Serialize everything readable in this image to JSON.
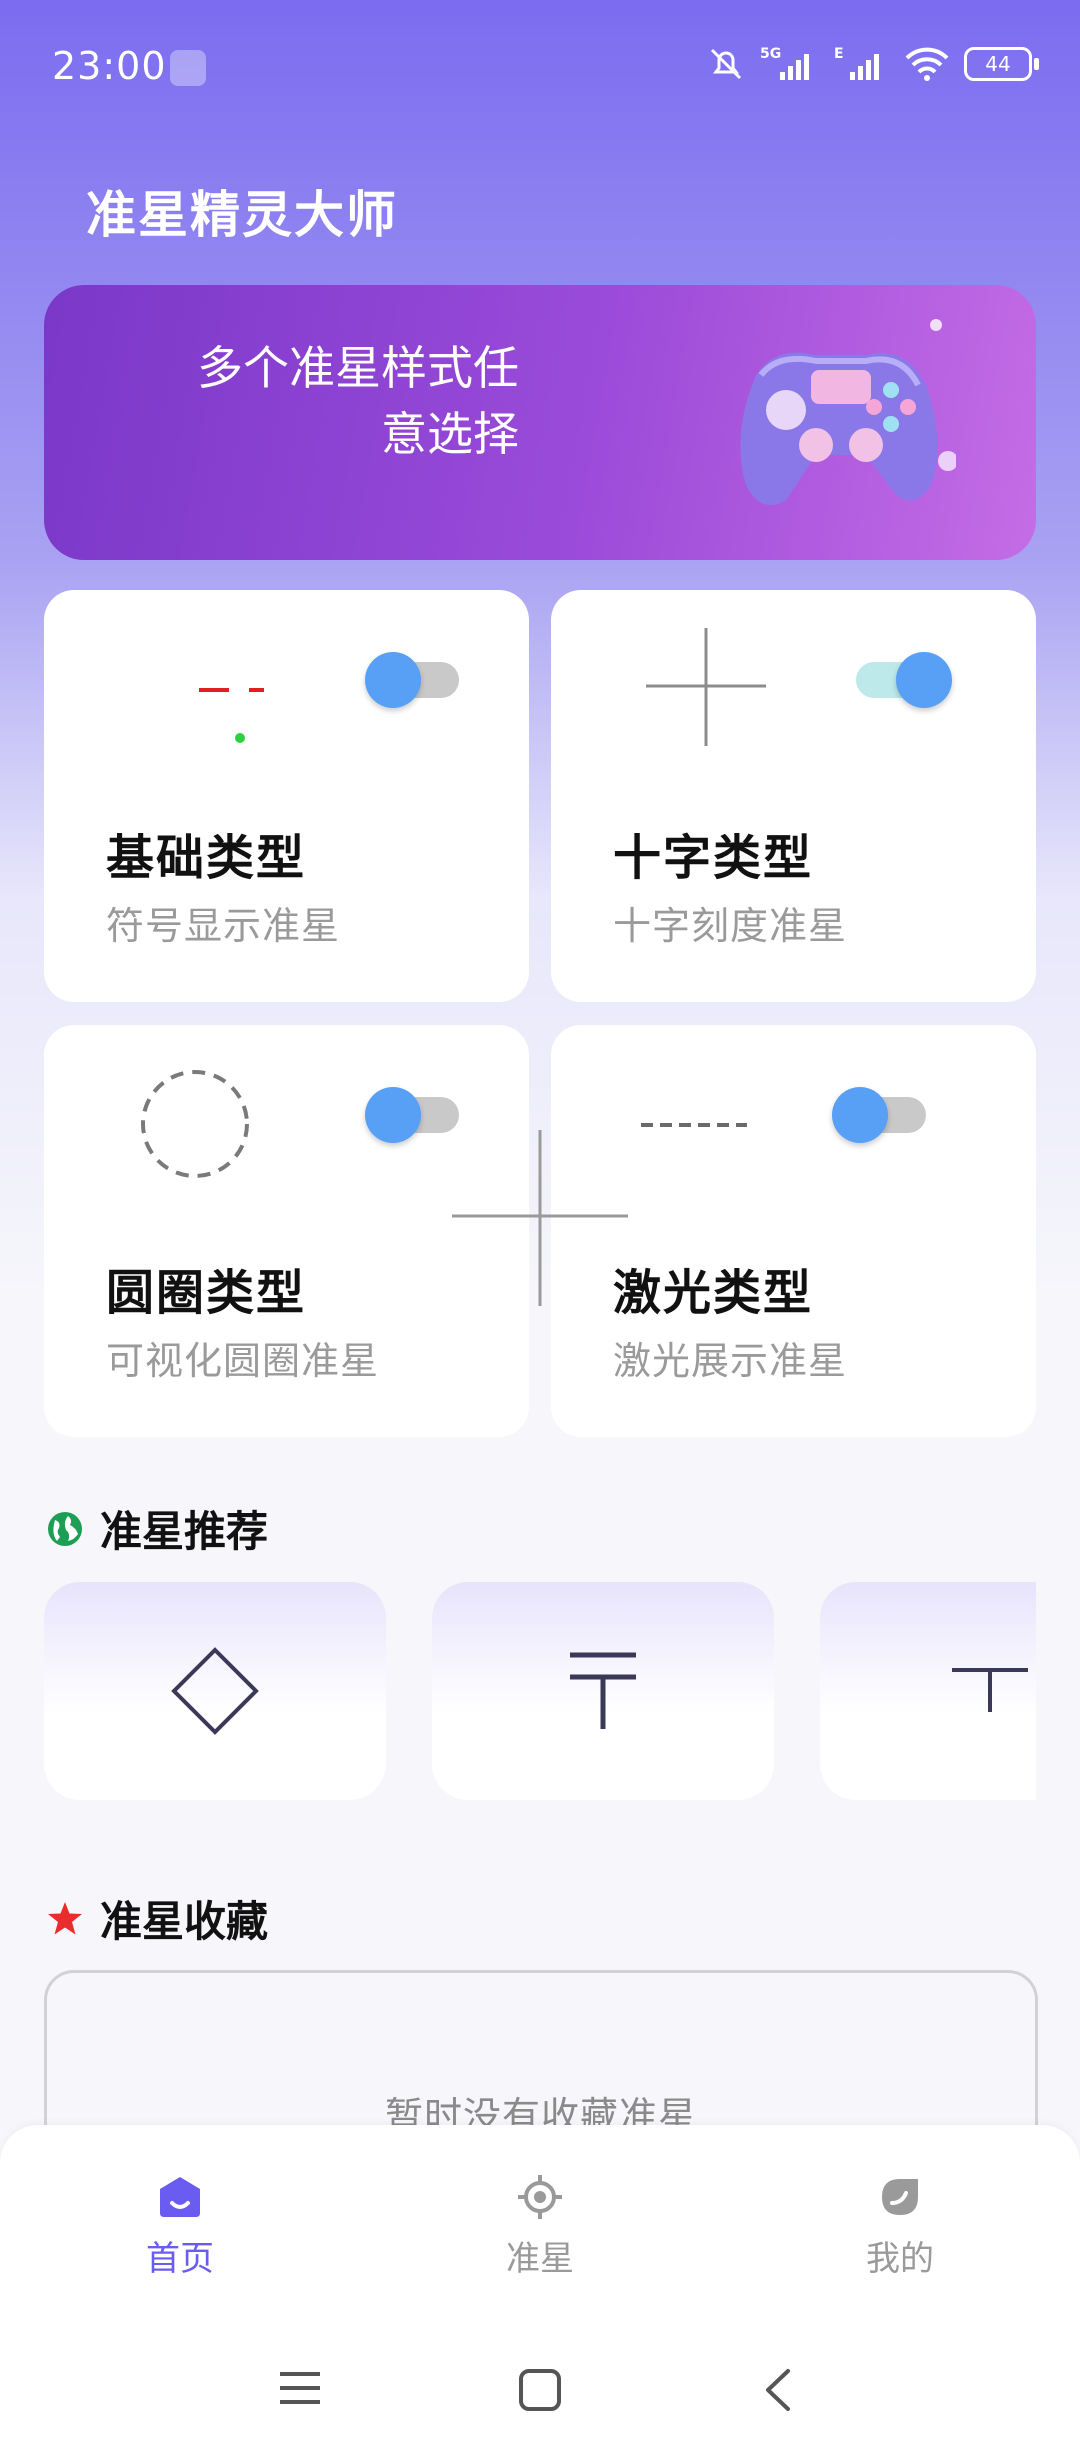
{
  "status_bar": {
    "time": "23:00",
    "battery": "44"
  },
  "app": {
    "title": "准星精灵大师"
  },
  "banner": {
    "line1": "多个准星样式任",
    "line2": "意选择"
  },
  "cards": [
    {
      "title": "基础类型",
      "subtitle": "符号显示准星",
      "enabled": false
    },
    {
      "title": "十字类型",
      "subtitle": "十字刻度准星",
      "enabled": true
    },
    {
      "title": "圆圈类型",
      "subtitle": "可视化圆圈准星",
      "enabled": false
    },
    {
      "title": "激光类型",
      "subtitle": "激光展示准星",
      "enabled": false
    }
  ],
  "recommend": {
    "title": "准星推荐"
  },
  "favorites": {
    "title": "准星收藏",
    "empty_text": "暂时没有收藏准星"
  },
  "tabs": [
    {
      "label": "首页",
      "active": true,
      "icon": "home-icon"
    },
    {
      "label": "准星",
      "active": false,
      "icon": "crosshair-icon"
    },
    {
      "label": "我的",
      "active": false,
      "icon": "profile-icon"
    }
  ],
  "colors": {
    "accent": "#6a5cf0",
    "toggle_knob": "#58a0f5"
  }
}
